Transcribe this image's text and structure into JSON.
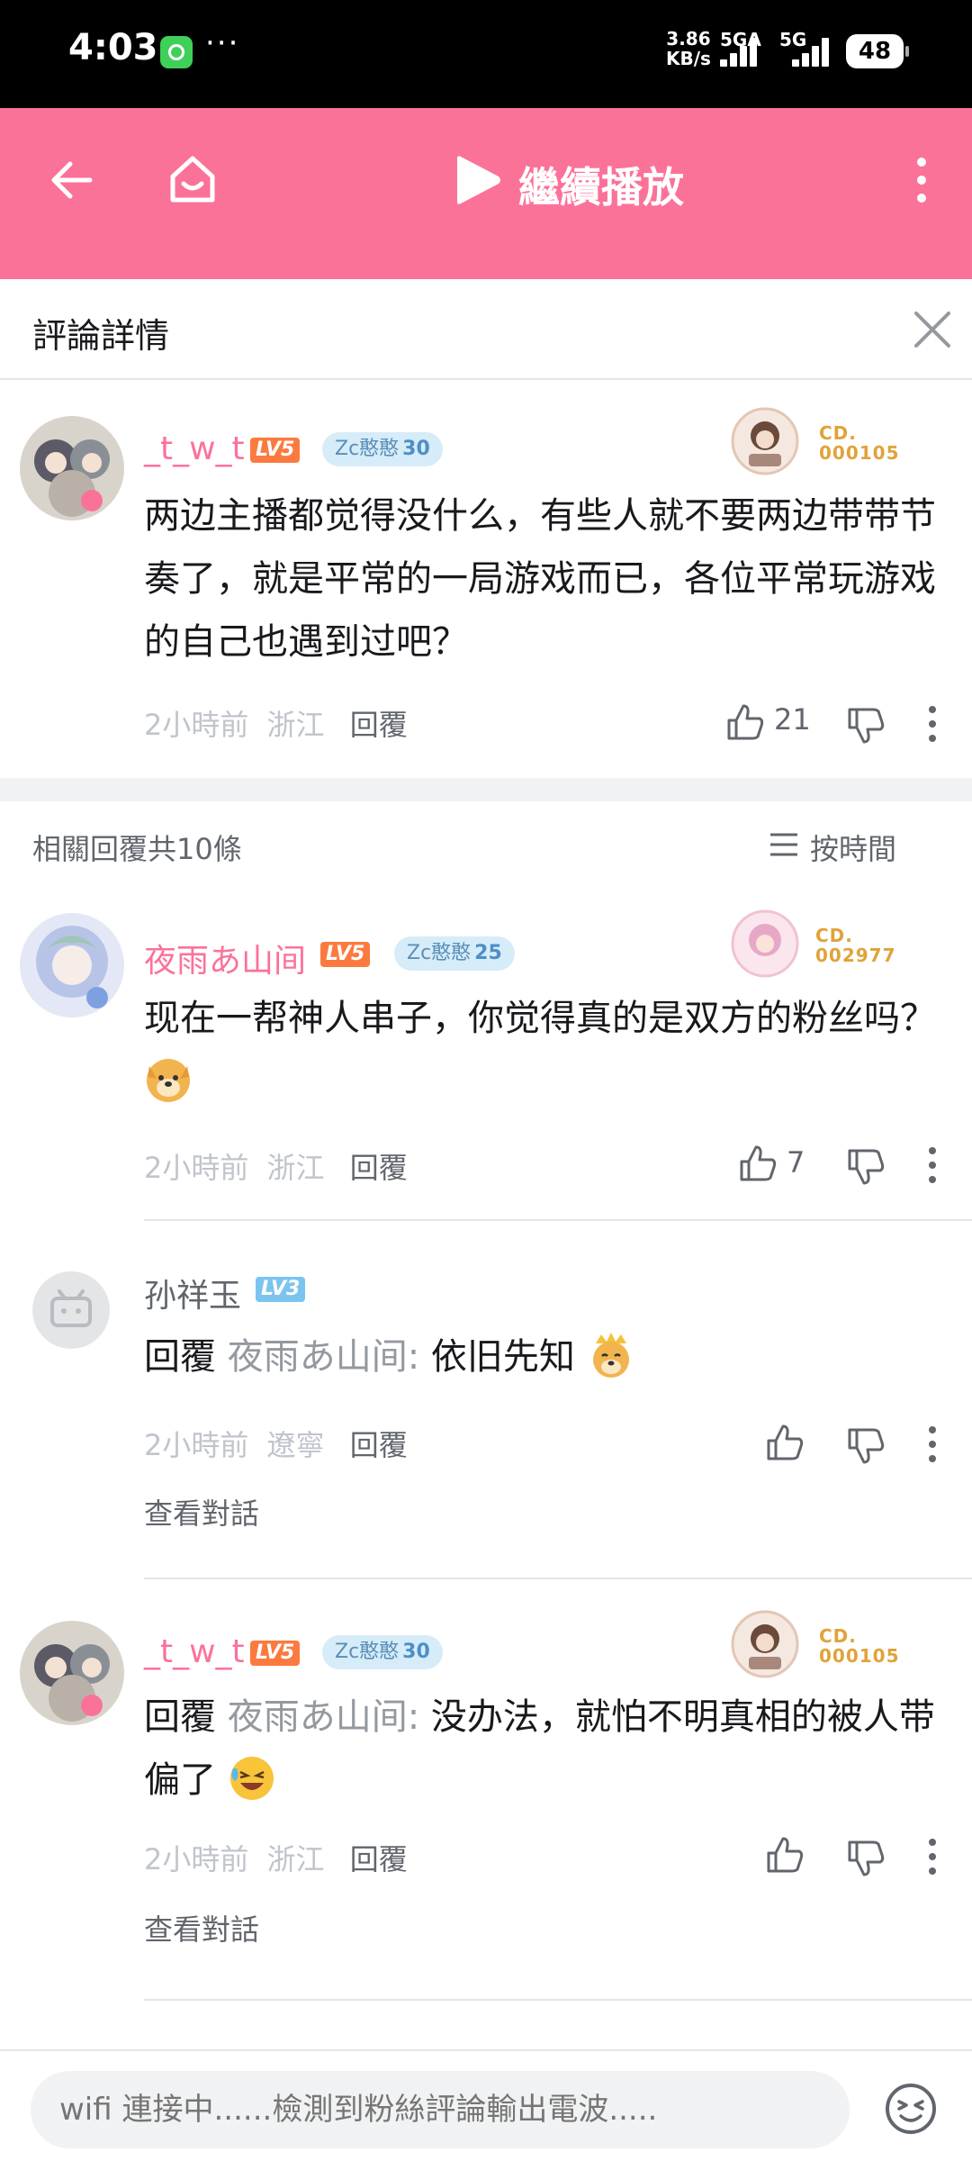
{
  "status_bar": {
    "time": "4:03",
    "dots": "···",
    "speed": "3.86\nKB/s",
    "net1": "5GA",
    "net2": "5G",
    "battery": "48"
  },
  "top_bar": {
    "title": "繼續播放",
    "icons": [
      "back-arrow-icon",
      "home-icon",
      "play-icon",
      "more-vertical-icon"
    ]
  },
  "detail_header": {
    "title": "評論詳情"
  },
  "main_comment": {
    "user": "_t_w_t",
    "level": "LV5",
    "medal_name": "Zc憨憨",
    "medal_level": "30",
    "fan_id_line1": "CD.",
    "fan_id_line2": "000105",
    "text": "两边主播都觉得没什么，有些人就不要两边带带节奏了，就是平常的一局游戏而已，各位平常玩游戏的自己也遇到过吧？",
    "time": "2小時前",
    "location": "浙江",
    "reply_label": "回覆",
    "likes": "21"
  },
  "related": {
    "header": "相關回覆共10條",
    "sort_label": "按時間"
  },
  "replies": [
    {
      "user": "夜雨あ山间",
      "level": "LV5",
      "medal_name": "Zc憨憨",
      "medal_level": "25",
      "fan_id_line1": "CD.",
      "fan_id_line2": "002977",
      "text": "现在一帮神人串子，你觉得真的是双方的粉丝吗？",
      "time": "2小時前",
      "location": "浙江",
      "reply_label": "回覆",
      "likes": "7"
    },
    {
      "user": "孙祥玉",
      "level": "LV3",
      "reply_prefix": "回覆",
      "reply_to": "夜雨あ山间:",
      "text": "依旧先知",
      "time": "2小時前",
      "location": "遼寧",
      "reply_label": "回覆",
      "view_conversation": "查看對話"
    },
    {
      "user": "_t_w_t",
      "level": "LV5",
      "medal_name": "Zc憨憨",
      "medal_level": "30",
      "fan_id_line1": "CD.",
      "fan_id_line2": "000105",
      "reply_prefix": "回覆",
      "reply_to": "夜雨あ山间:",
      "text": "没办法，就怕不明真相的被人带偏了",
      "time": "2小時前",
      "location": "浙江",
      "reply_label": "回覆",
      "view_conversation": "查看對話"
    }
  ],
  "bottom_input": {
    "placeholder": "wifi 連接中......檢測到粉絲評論輸出電波....."
  },
  "colors": {
    "brand_pink": "#fb7299",
    "level_orange": "#fb7a3f",
    "level_blue": "#7cc4f0",
    "medal_bg": "#d6ecf8",
    "fan_gold": "#e0a33a"
  }
}
